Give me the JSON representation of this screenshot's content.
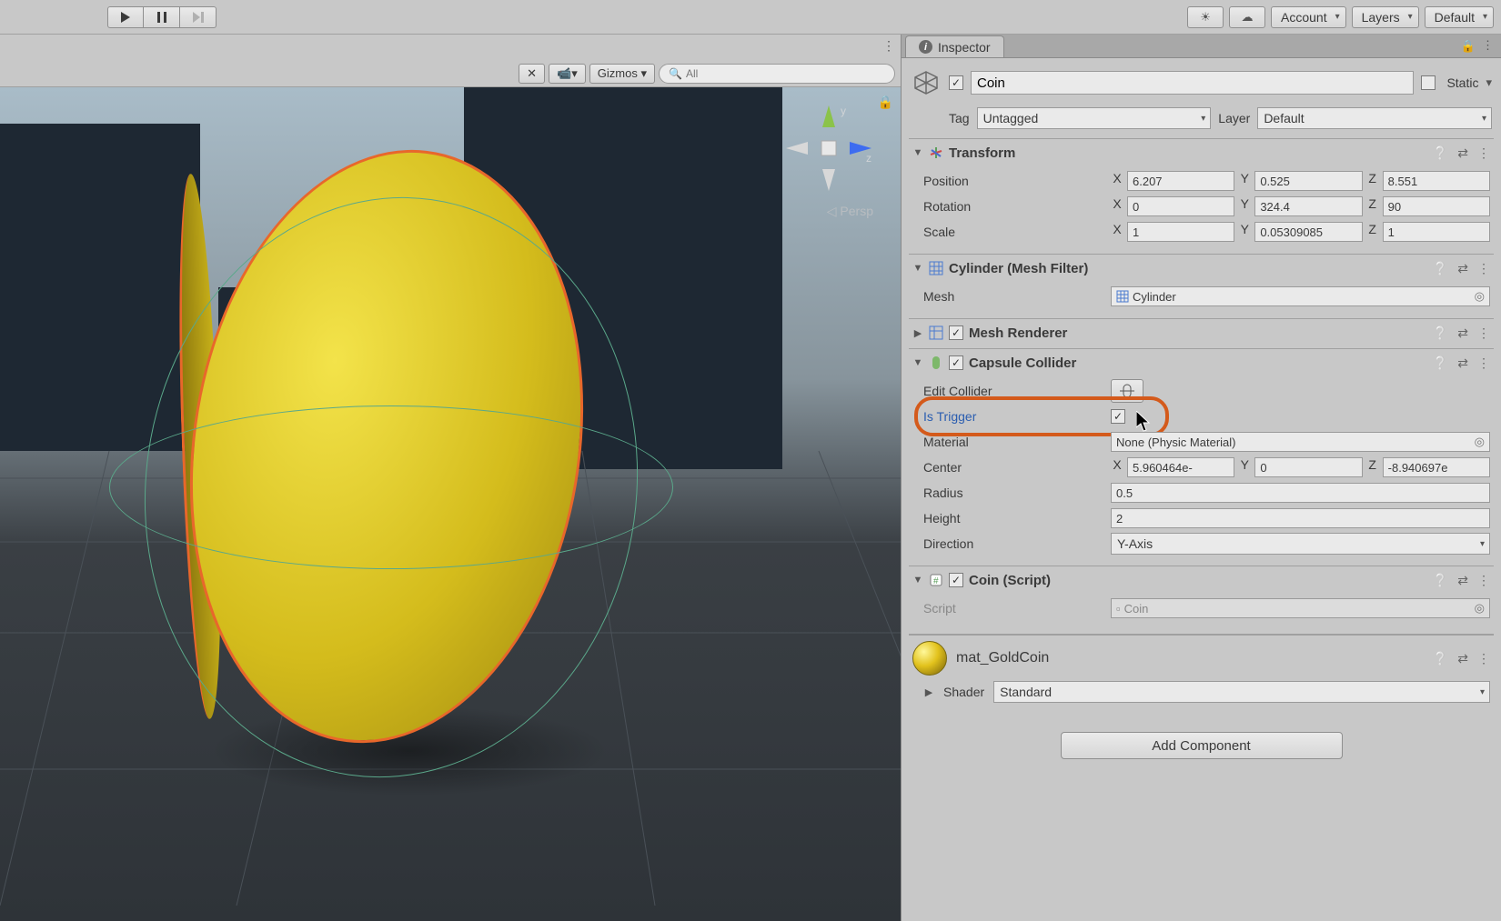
{
  "toolbar": {
    "account": "Account",
    "layers": "Layers",
    "layout": "Default"
  },
  "scene": {
    "gizmos_label": "Gizmos",
    "search_placeholder": "All",
    "persp_label": "Persp",
    "axis_y": "y",
    "axis_z": "z"
  },
  "inspector": {
    "tab": "Inspector",
    "object_name": "Coin",
    "static_label": "Static",
    "tag_label": "Tag",
    "tag_value": "Untagged",
    "layer_label": "Layer",
    "layer_value": "Default"
  },
  "transform": {
    "title": "Transform",
    "position_label": "Position",
    "position": {
      "x": "6.207",
      "y": "0.525",
      "z": "8.551"
    },
    "rotation_label": "Rotation",
    "rotation": {
      "x": "0",
      "y": "324.4",
      "z": "90"
    },
    "scale_label": "Scale",
    "scale": {
      "x": "1",
      "y": "0.05309085",
      "z": "1"
    }
  },
  "meshfilter": {
    "title": "Cylinder (Mesh Filter)",
    "mesh_label": "Mesh",
    "mesh_value": "Cylinder"
  },
  "meshrenderer": {
    "title": "Mesh Renderer"
  },
  "capsule": {
    "title": "Capsule Collider",
    "edit_label": "Edit Collider",
    "istrigger_label": "Is Trigger",
    "material_label": "Material",
    "material_value": "None (Physic Material)",
    "center_label": "Center",
    "center": {
      "x": "5.960464e-",
      "y": "0",
      "z": "-8.940697e"
    },
    "radius_label": "Radius",
    "radius": "0.5",
    "height_label": "Height",
    "height": "2",
    "direction_label": "Direction",
    "direction": "Y-Axis"
  },
  "coinscript": {
    "title": "Coin (Script)",
    "script_label": "Script",
    "script_value": "Coin"
  },
  "material": {
    "name": "mat_GoldCoin",
    "shader_label": "Shader",
    "shader_value": "Standard"
  },
  "add_component": "Add Component",
  "labels": {
    "x": "X",
    "y": "Y",
    "z": "Z"
  }
}
